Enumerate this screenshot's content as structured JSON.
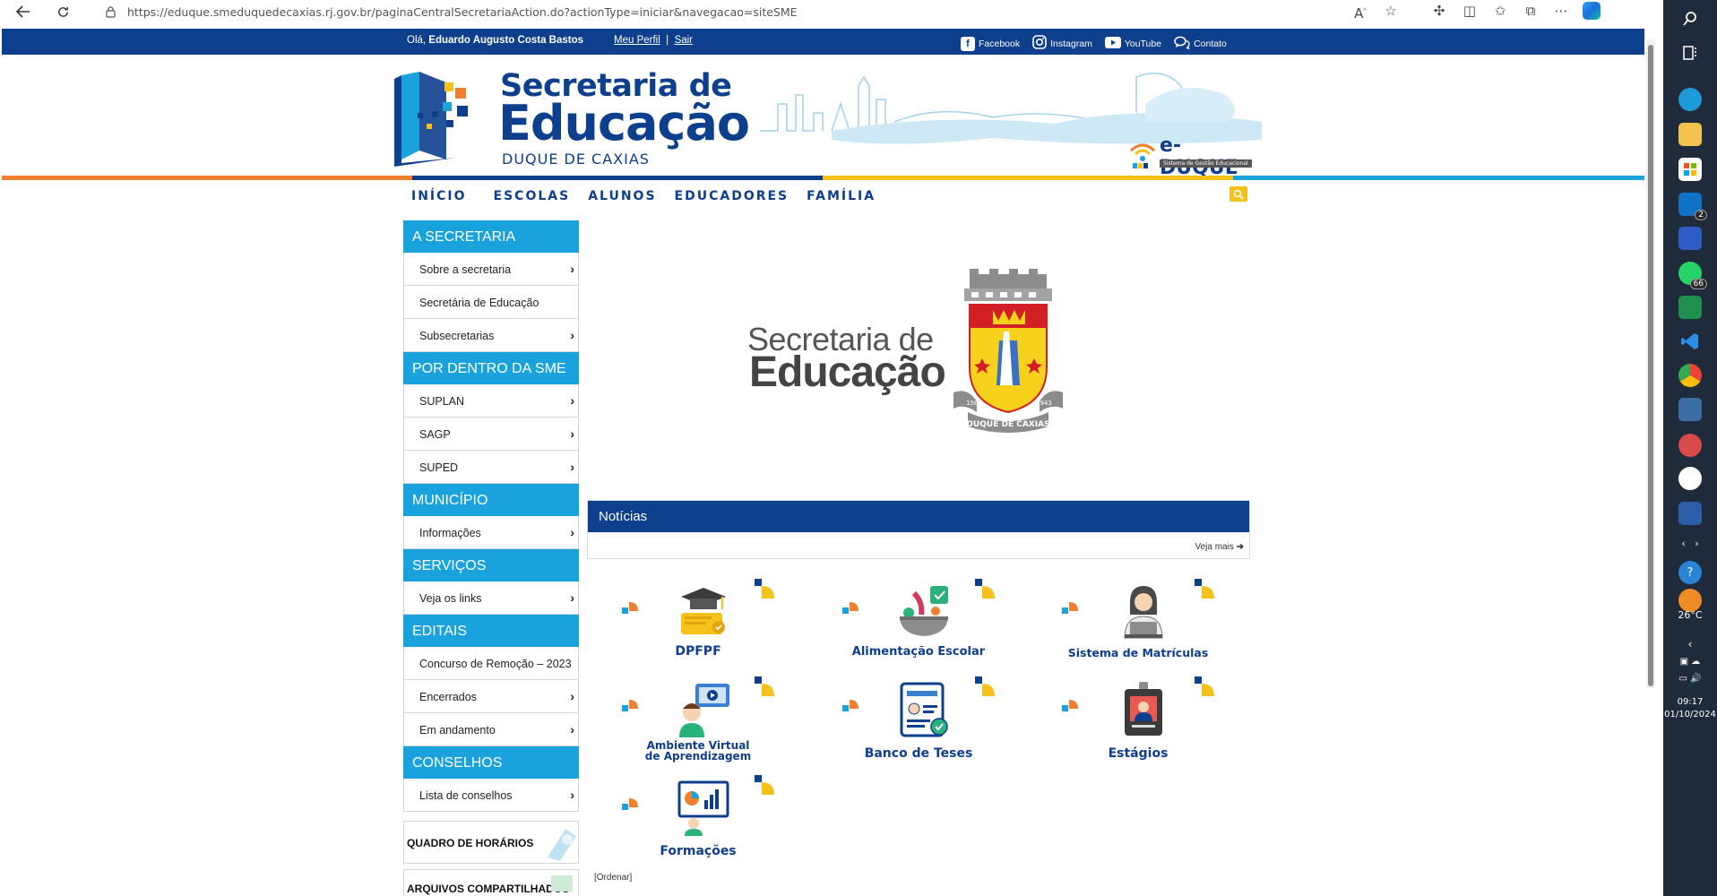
{
  "browser": {
    "url": "https://eduque.smeduquedecaxias.rj.gov.br/paginaCentralSecretariaAction.do?actionType=iniciar&navegacao=siteSME"
  },
  "topbar": {
    "greeting_prefix": "Olá,",
    "user_name": "Eduardo Augusto Costa Bastos",
    "profile_link": "Meu Perfil",
    "separator": "|",
    "logout_link": "Sair",
    "social": [
      {
        "label": "Facebook",
        "icon": "facebook-icon"
      },
      {
        "label": "Instagram",
        "icon": "instagram-icon"
      },
      {
        "label": "YouTube",
        "icon": "youtube-icon"
      },
      {
        "label": "Contato",
        "icon": "chat-icon"
      }
    ]
  },
  "header": {
    "title_line1": "Secretaria de",
    "title_line2": "Educação",
    "title_line3": "DUQUE DE CAXIAS",
    "eduque_name": "e-DUQUE",
    "eduque_sub": "Sistema de Gestão Educacional"
  },
  "nav": {
    "items": [
      "INÍCIO",
      "ESCOLAS",
      "ALUNOS",
      "EDUCADORES",
      "FAMÍLIA"
    ]
  },
  "sidebar": {
    "sections": [
      {
        "title": "A SECRETARIA",
        "items": [
          {
            "label": "Sobre a secretaria",
            "arrow": true
          },
          {
            "label": "Secretária de Educação",
            "arrow": false
          },
          {
            "label": "Subsecretarias",
            "arrow": true
          }
        ]
      },
      {
        "title": "POR DENTRO DA SME",
        "items": [
          {
            "label": "SUPLAN",
            "arrow": true
          },
          {
            "label": "SAGP",
            "arrow": true
          },
          {
            "label": "SUPED",
            "arrow": true
          }
        ]
      },
      {
        "title": "MUNICÍPIO",
        "items": [
          {
            "label": "Informações",
            "arrow": true
          }
        ]
      },
      {
        "title": "SERVIÇOS",
        "items": [
          {
            "label": "Veja os links",
            "arrow": true
          }
        ]
      },
      {
        "title": "EDITAIS",
        "items": [
          {
            "label": "Concurso de Remoção – 2023",
            "arrow": false
          },
          {
            "label": "Encerrados",
            "arrow": true
          },
          {
            "label": "Em andamento",
            "arrow": true
          }
        ]
      },
      {
        "title": "CONSELHOS",
        "items": [
          {
            "label": "Lista de conselhos",
            "arrow": true
          }
        ]
      }
    ],
    "cards": [
      "QUADRO DE HORÁRIOS",
      "ARQUIVOS COMPARTILHADOS"
    ]
  },
  "center_logo": {
    "line1": "Secretaria de",
    "line2": "Educação",
    "crest_text": "DUQUE DE CAXIAS",
    "year_left": "1566",
    "year_right": "1943"
  },
  "news": {
    "title": "Notícias",
    "more": "Veja mais"
  },
  "services": [
    {
      "label": "DPFPF",
      "icon": "graduation-cap-diploma-icon"
    },
    {
      "label": "Alimentação Escolar",
      "icon": "food-bowl-icon"
    },
    {
      "label": "Sistema de Matrículas",
      "icon": "student-laptop-icon"
    },
    {
      "label": "Ambiente Virtual de Aprendizagem",
      "line1": "Ambiente Virtual",
      "line2": "de Aprendizagem",
      "icon": "online-class-icon"
    },
    {
      "label": "Banco de Teses",
      "icon": "document-check-icon"
    },
    {
      "label": "Estágios",
      "icon": "id-badge-icon"
    },
    {
      "label": "Formações",
      "icon": "presentation-board-icon"
    }
  ],
  "ordenar": "[Ordenar]",
  "taskbar": {
    "badges": {
      "mail": "2",
      "whatsapp": "66"
    },
    "weather": "26°C",
    "time": "09:17",
    "date": "01/10/2024"
  },
  "colors": {
    "brand_blue": "#0d3f8d",
    "sidebar_cyan": "#1aa2dc",
    "accent_yellow": "#f5c21b",
    "accent_orange": "#f07f2e"
  }
}
